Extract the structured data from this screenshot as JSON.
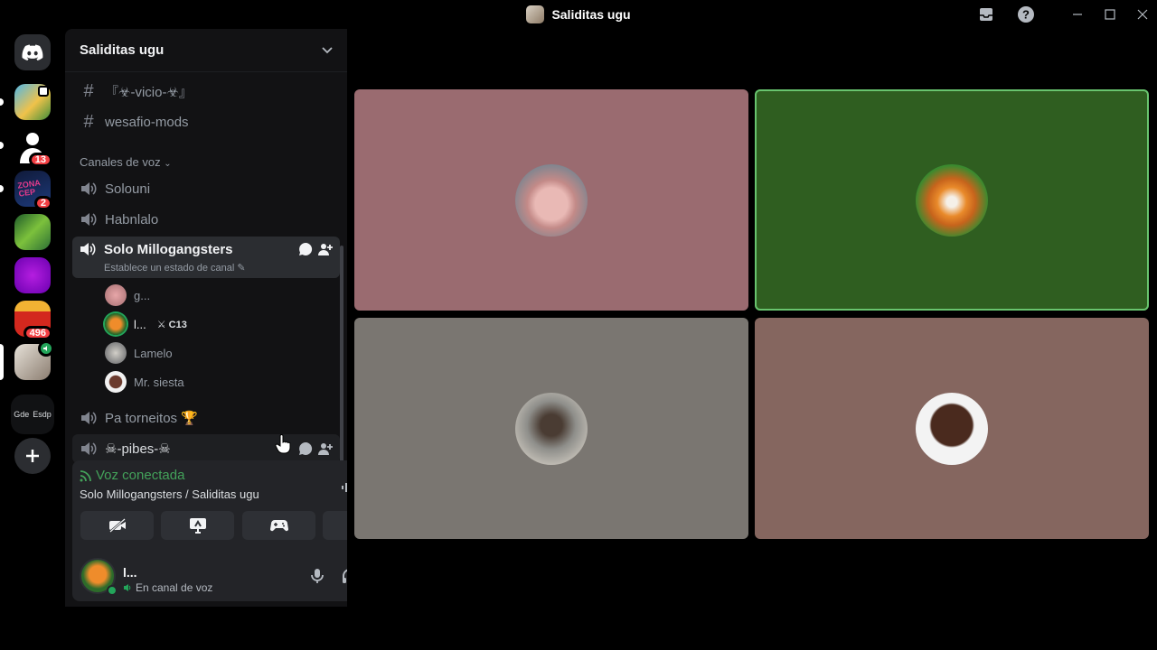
{
  "window": {
    "title": "Saliditas ugu"
  },
  "rail": {
    "folder_labels": [
      "Gde",
      "Esdp"
    ],
    "badges": [
      "13",
      "2",
      "496"
    ]
  },
  "guild": {
    "name": "Saliditas ugu"
  },
  "text_channels": [
    "『☣-vicio-☣』",
    "wesafio-mods"
  ],
  "voice_category": "Canales de voz",
  "voice_channels": {
    "solouni": "Solouni",
    "habnlalo": "Habnlalo",
    "active": {
      "name": "Solo Millogangsters",
      "status": "Establece un estado de canal"
    },
    "torneitos": "Pa torneitos 🏆",
    "pibes": "☠-pibes-☠"
  },
  "voice_users": [
    {
      "name": "g..."
    },
    {
      "name": "l...",
      "tag": "C13"
    },
    {
      "name": "Lamelo"
    },
    {
      "name": "Mr. siesta"
    }
  ],
  "voice_panel": {
    "status": "Voz conectada",
    "location": "Solo Millogangsters / Saliditas ugu"
  },
  "user": {
    "name": "l...",
    "status": "En canal de voz"
  },
  "colors": {
    "tile1": "#9a6b70",
    "tile2": "#2f5e20",
    "tile3": "#7a7671",
    "tile4": "#85665f",
    "speaking": "#68c46e",
    "online": "#23a55a"
  }
}
